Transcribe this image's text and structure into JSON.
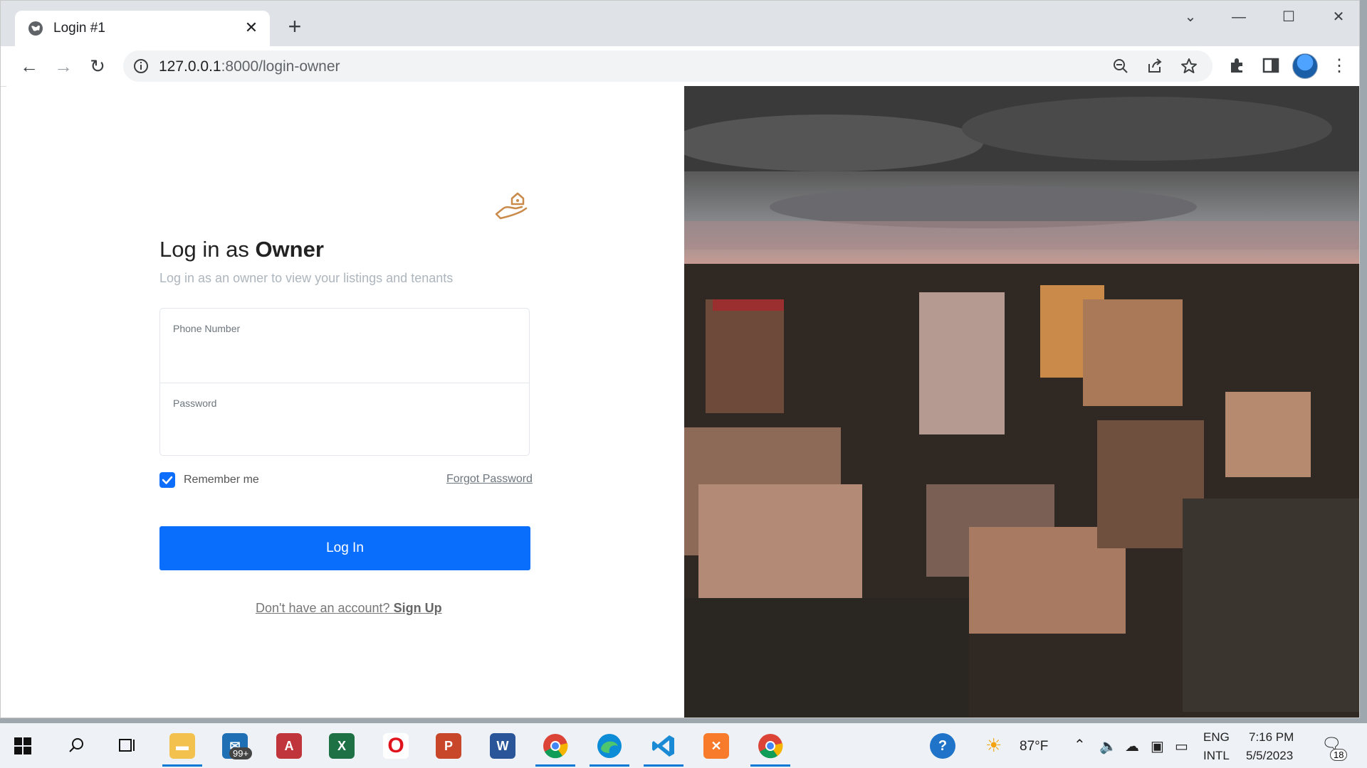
{
  "browser": {
    "tab_title": "Login #1",
    "url_host": "127.0.0.1",
    "url_path": ":8000/login-owner"
  },
  "page": {
    "heading_prefix": "Log in as ",
    "heading_bold": "Owner",
    "subtitle": "Log in as an owner to view your listings and tenants",
    "phone_label": "Phone Number",
    "phone_value": "",
    "password_label": "Password",
    "password_value": "",
    "remember_label": "Remember me",
    "remember_checked": true,
    "forgot_label": "Forgot Password",
    "login_button": "Log In",
    "signup_prefix": "Don't have an account? ",
    "signup_link": "Sign Up"
  },
  "taskbar": {
    "mail_badge": "99+",
    "weather": "87°F",
    "lang_top": "ENG",
    "lang_bottom": "INTL",
    "time": "7:16 PM",
    "date": "5/5/2023",
    "notification_count": "18"
  },
  "colors": {
    "primary": "#0a6efd",
    "logo": "#c98a4a"
  }
}
